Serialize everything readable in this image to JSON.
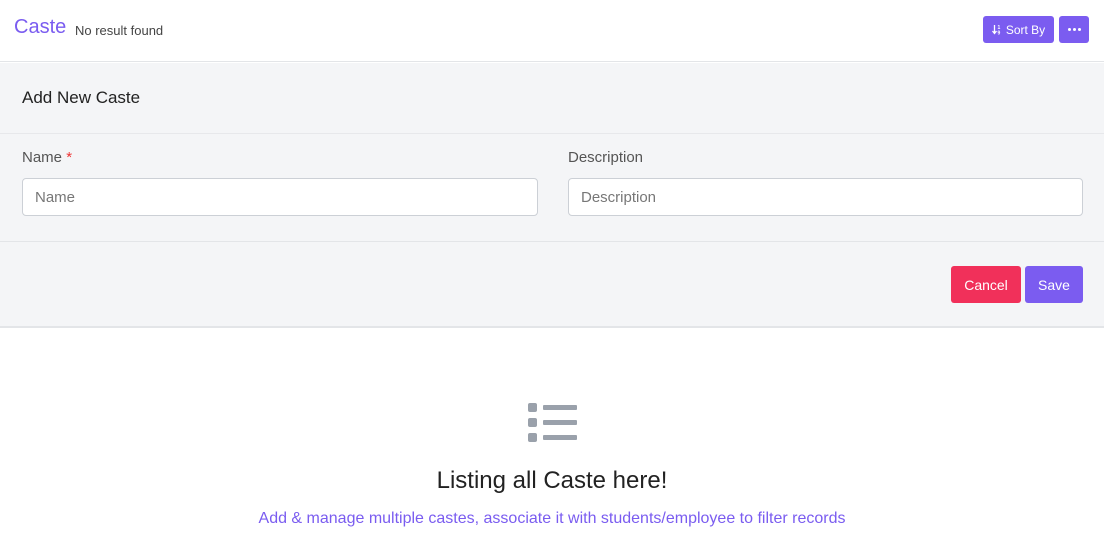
{
  "header": {
    "title": "Caste",
    "subtitle": "No result found",
    "sort_label": "Sort By",
    "sort_icon": "sort-numeric-icon",
    "more_icon": "ellipsis-icon"
  },
  "form": {
    "title": "Add New Caste",
    "name_label": "Name",
    "name_required_mark": "*",
    "name_placeholder": "Name",
    "name_value": "",
    "description_label": "Description",
    "description_placeholder": "Description",
    "description_value": "",
    "cancel_label": "Cancel",
    "save_label": "Save"
  },
  "empty_state": {
    "icon": "list-icon",
    "title": "Listing all Caste here!",
    "description": "Add & manage multiple castes, associate it with students/employee to filter records"
  },
  "colors": {
    "accent": "#7b5cf0",
    "danger": "#f1305a",
    "panel_bg": "#f4f5f7"
  }
}
